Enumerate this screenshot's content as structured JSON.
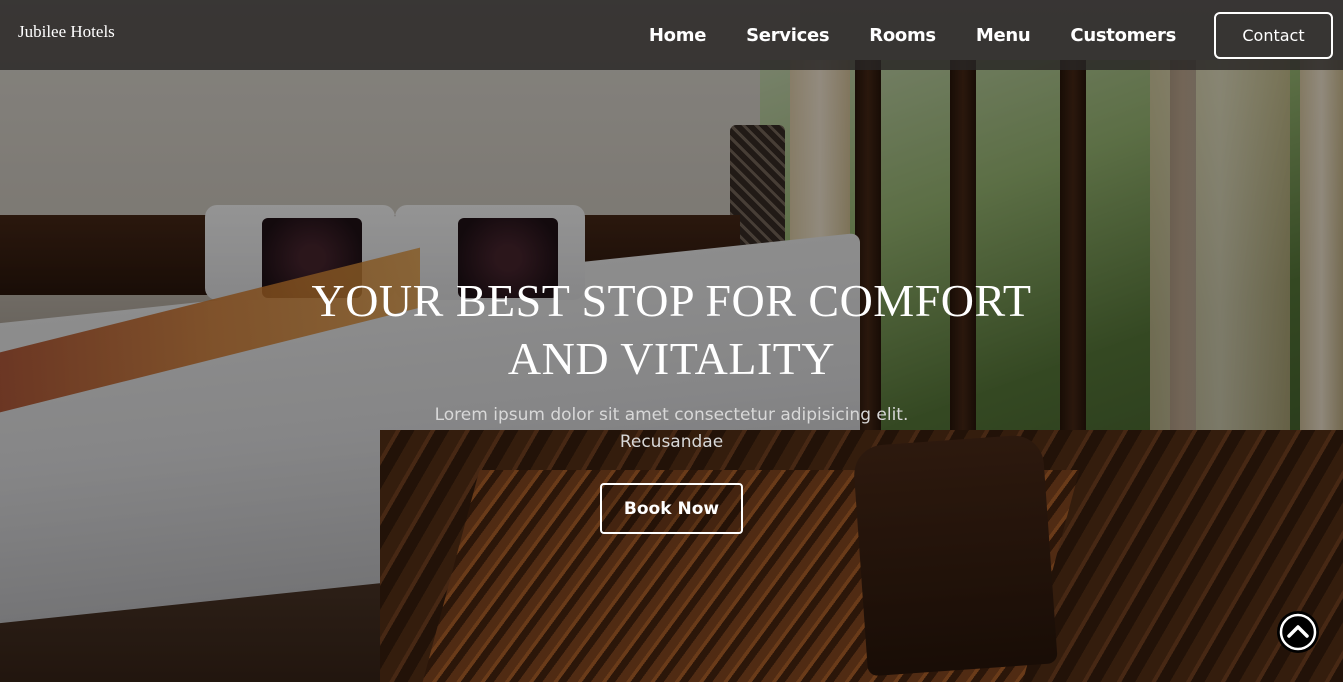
{
  "header": {
    "brand": "Jubilee Hotels",
    "nav": [
      {
        "label": "Home"
      },
      {
        "label": "Services"
      },
      {
        "label": "Rooms"
      },
      {
        "label": "Menu"
      },
      {
        "label": "Customers"
      }
    ],
    "contact_label": "Contact"
  },
  "hero": {
    "title": "YOUR BEST STOP FOR COMFORT AND VITALITY",
    "subtitle": "Lorem ipsum dolor sit amet consectetur adipisicing elit. Recusandae",
    "cta_label": "Book Now",
    "background_image": "hotel-bedroom-photo"
  },
  "scroll_top": {
    "icon": "chevron-up-circle-icon"
  },
  "colors": {
    "nav_background": "#282624",
    "text": "#ffffff",
    "subtitle_text": "#d8d8d8",
    "scroll_button": "#000000"
  }
}
